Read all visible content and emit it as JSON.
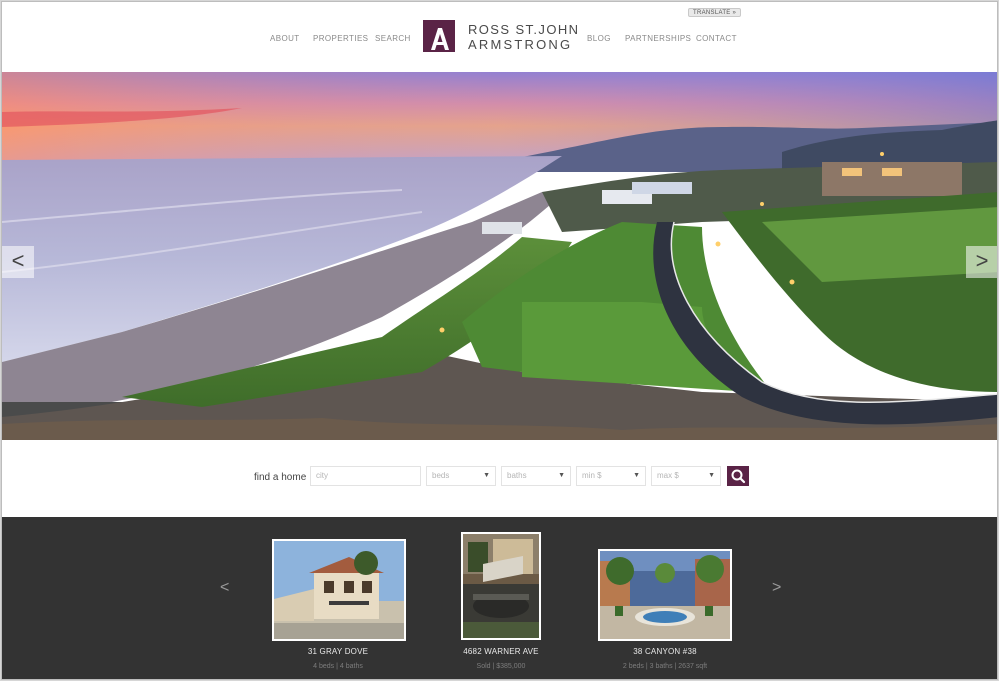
{
  "header": {
    "nav_left": [
      "ABOUT",
      "PROPERTIES",
      "SEARCH"
    ],
    "nav_right": [
      "BLOG",
      "PARTNERSHIPS",
      "CONTACT"
    ],
    "logo_line1": "ROSS ST.JOHN",
    "logo_line2": "ARMSTRONG",
    "translate_label": "TRANSLATE »",
    "brand_color": "#5a2346"
  },
  "hero": {
    "prev_label": "<",
    "next_label": ">"
  },
  "search": {
    "label": "find a home",
    "city_placeholder": "city",
    "beds_label": "beds",
    "baths_label": "baths",
    "min_label": "min $",
    "max_label": "max $",
    "button_icon": "search-icon"
  },
  "listings": {
    "prev_label": "<",
    "next_label": ">",
    "items": [
      {
        "address": "31 GRAY DOVE",
        "details": "4 beds | 4 baths"
      },
      {
        "address": "4682 WARNER AVE",
        "details": "Sold | $385,000"
      },
      {
        "address": "38 CANYON #38",
        "details": "2 beds | 3 baths | 2637 sqft"
      }
    ]
  }
}
